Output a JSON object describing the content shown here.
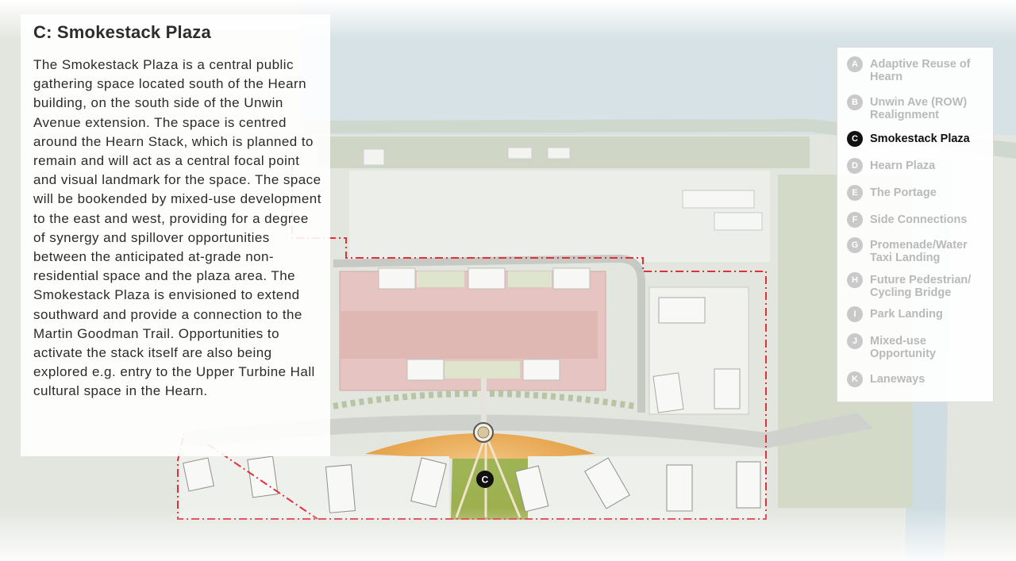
{
  "title": "C: Smokestack Plaza",
  "description": "The Smokestack Plaza is a central public gathering space located south of the Hearn building, on the south side of the Unwin Avenue extension. The space is centred around the Hearn Stack, which is planned to remain and will act as a central focal point and visual landmark for the space. The space will be bookended by mixed-use development to the east and west, providing for a degree of synergy and spillover opportunities between the anticipated at-grade non-residential space and the plaza area. The Smokestack Plaza is envisioned to extend southward and provide a connection to the Martin Goodman Trail. Opportunities to activate the stack itself are also being explored e.g. entry to the Upper Turbine Hall cultural space in the Hearn.",
  "legend": {
    "items": [
      {
        "letter": "A",
        "label": "Adaptive Reuse of Hearn",
        "active": false
      },
      {
        "letter": "B",
        "label": "Unwin Ave (ROW) Realignment",
        "active": false
      },
      {
        "letter": "C",
        "label": "Smokestack Plaza",
        "active": true
      },
      {
        "letter": "D",
        "label": "Hearn Plaza",
        "active": false
      },
      {
        "letter": "E",
        "label": "The Portage",
        "active": false
      },
      {
        "letter": "F",
        "label": "Side Connections",
        "active": false
      },
      {
        "letter": "G",
        "label": "Promenade/Water Taxi Landing",
        "active": false
      },
      {
        "letter": "H",
        "label": "Future Pedestrian/ Cycling Bridge",
        "active": false
      },
      {
        "letter": "I",
        "label": "Park Landing",
        "active": false
      },
      {
        "letter": "J",
        "label": "Mixed-use Opportunity",
        "active": false
      },
      {
        "letter": "K",
        "label": "Laneways",
        "active": false
      }
    ]
  },
  "map": {
    "marker_label": "C",
    "colors": {
      "water": "#d7e3e6",
      "boundary": "#e0303a",
      "plaza": "#e9a64a",
      "park": "#8fb24f",
      "building_roof": "#e8c6c3",
      "ground": "#e6e8e2",
      "greenery": "#c9d4bb"
    }
  }
}
